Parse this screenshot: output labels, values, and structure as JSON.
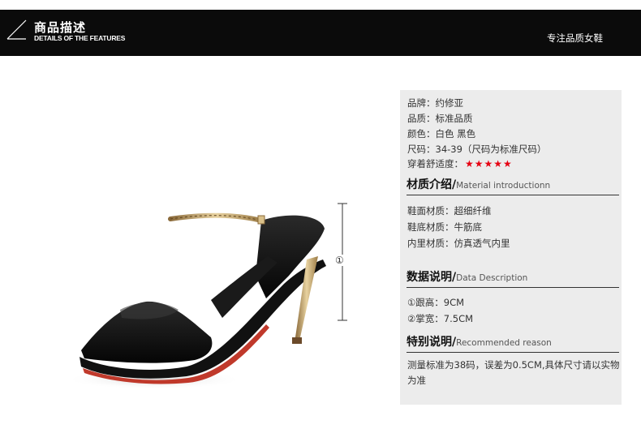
{
  "header": {
    "title_cn": "商品描述",
    "title_en": "DETAILS OF THE FEATURES",
    "tagline": "专注品质女鞋"
  },
  "product": {
    "image": "black-open-toe-heel-sandal",
    "dimension_marker": "①"
  },
  "basic_info": {
    "brand": "品牌：约修亚",
    "quality": "品质：标准品质",
    "color": "颜色：白色 黑色",
    "size": "尺码：34-39（尺码为标准尺码）",
    "comfort_label": "穿着舒适度：",
    "comfort_stars": "★★★★★",
    "star_color": "#e60012"
  },
  "material": {
    "title_cn": "材质介绍/",
    "title_en": "Material introductionn",
    "items": [
      "鞋面材质：超细纤维",
      "鞋底材质：牛筋底",
      "内里材质：仿真透气内里"
    ]
  },
  "data": {
    "title_cn": "数据说明/",
    "title_en": "Data Description",
    "items": [
      "①跟高：9CM",
      "②掌宽：7.5CM"
    ]
  },
  "reason": {
    "title_cn": "特别说明/",
    "title_en": "Recommended reason",
    "text": "测量标准为38码，误差为0.5CM,具体尺寸请以实物为准"
  }
}
